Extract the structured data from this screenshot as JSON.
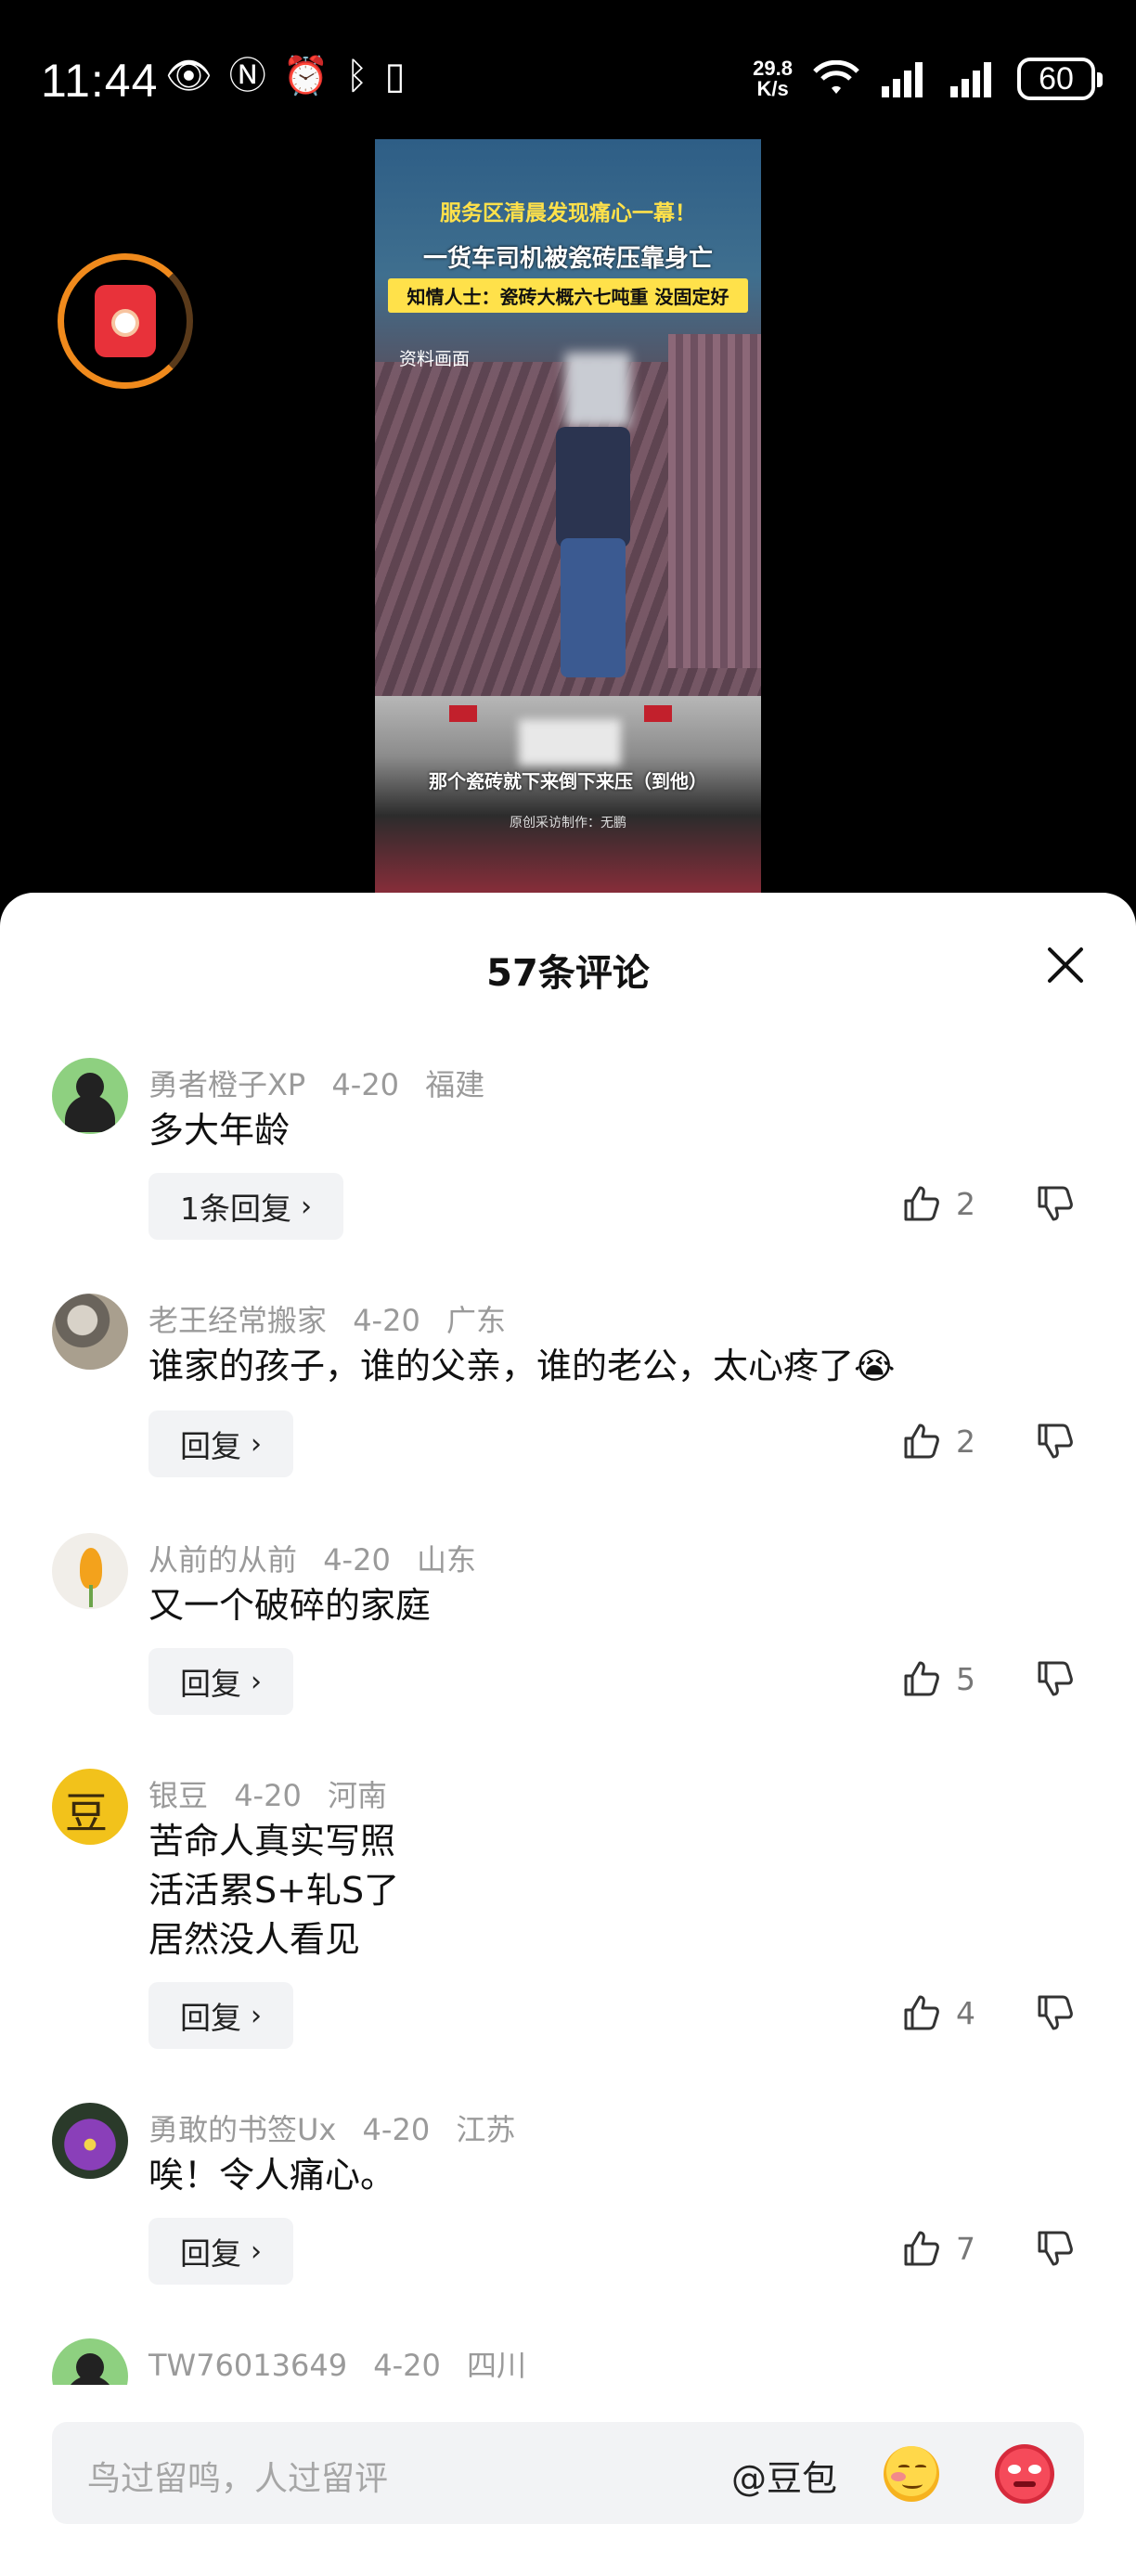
{
  "status_bar": {
    "time": "11:44",
    "net_speed_value": "29.8",
    "net_speed_unit": "K/s",
    "battery": "60"
  },
  "video": {
    "headline_1": "服务区清晨发现痛心一幕！",
    "headline_2": "一货车司机被瓷砖压靠身亡",
    "headline_3": "知情人士：瓷砖大概六七吨重 没固定好",
    "tag": "资料画面",
    "subtitle": "那个瓷砖就下来倒下来压（到他）",
    "credit": "原创采访制作：无鹏"
  },
  "comments_panel": {
    "title": "57条评论",
    "comments": [
      {
        "user": "勇者橙子XP",
        "date": "4-20",
        "region": "福建",
        "lines": [
          "多大年龄"
        ],
        "reply_label": "1条回复",
        "likes": "2",
        "avatar": "default-avatar"
      },
      {
        "user": "老王经常搬家",
        "date": "4-20",
        "region": "广东",
        "lines": [
          "谁家的孩子，谁的父亲，谁的老公，太心疼了😭"
        ],
        "reply_label": "回复",
        "likes": "2",
        "avatar": "dog-avatar"
      },
      {
        "user": "从前的从前",
        "date": "4-20",
        "region": "山东",
        "lines": [
          "又一个破碎的家庭"
        ],
        "reply_label": "回复",
        "likes": "5",
        "avatar": "flower-avatar"
      },
      {
        "user": "银豆",
        "date": "4-20",
        "region": "河南",
        "lines": [
          "苦命人真实写照",
          "活活累S+轧S了",
          "居然没人看见"
        ],
        "reply_label": "回复",
        "likes": "4",
        "avatar": "calligraphy-avatar"
      },
      {
        "user": "勇敢的书签Ux",
        "date": "4-20",
        "region": "江苏",
        "lines": [
          "唉！令人痛心。"
        ],
        "reply_label": "回复",
        "likes": "7",
        "avatar": "lotus-avatar"
      },
      {
        "user": "TW76013649",
        "date": "4-20",
        "region": "四川",
        "lines": [],
        "reply_label": "",
        "likes": "",
        "avatar": "default-avatar"
      }
    ]
  },
  "input_bar": {
    "placeholder": "鸟过留鸣，人过留评",
    "mention_label": "@豆包"
  },
  "colors": {
    "accent_orange": "#f08a1c",
    "red_packet": "#e8323a",
    "meta_gray": "#9a9a9a"
  }
}
